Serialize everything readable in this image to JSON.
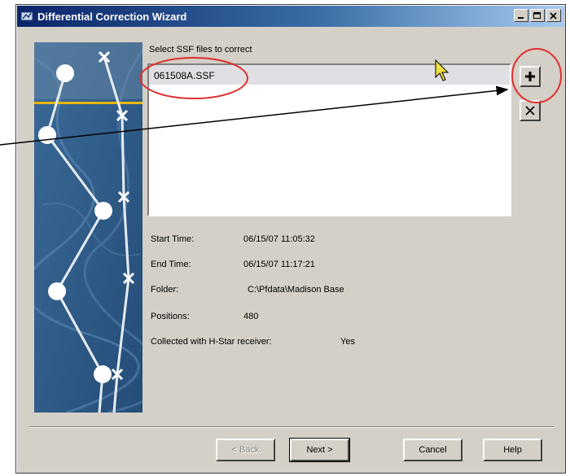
{
  "window": {
    "title": "Differential Correction Wizard"
  },
  "main": {
    "prompt": "Select SSF files to correct",
    "files": [
      "061508A.SSF"
    ]
  },
  "info": {
    "start_label": "Start Time:",
    "start_value": "06/15/07 11:05:32",
    "end_label": "End Time:",
    "end_value": "06/15/07 11:17:21",
    "folder_label": "Folder:",
    "folder_value": "C:\\Pfdata\\Madison Base",
    "positions_label": "Positions:",
    "positions_value": "480",
    "hstar_label": "Collected with H-Star receiver:",
    "hstar_value": "Yes"
  },
  "buttons": {
    "back": "< Back",
    "next": "Next >",
    "cancel": "Cancel",
    "help": "Help"
  },
  "icons": {
    "add": "plus-icon",
    "remove": "close-icon"
  },
  "colors": {
    "titlebar_start": "#0a246a",
    "titlebar_end": "#a6caf0",
    "annotation_red": "#e03030",
    "art_blue": "#2f5a86",
    "art_line": "#e8b400"
  }
}
